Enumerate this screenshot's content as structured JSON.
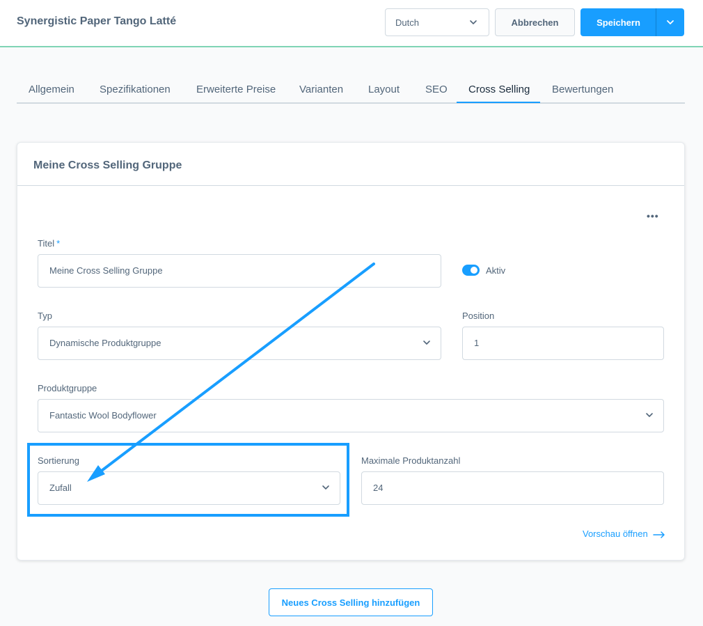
{
  "header": {
    "title": "Synergistic Paper Tango Latté",
    "language": "Dutch",
    "cancel_label": "Abbrechen",
    "save_label": "Speichern"
  },
  "tabs": [
    {
      "label": "Allgemein"
    },
    {
      "label": "Spezifikationen"
    },
    {
      "label": "Erweiterte Preise"
    },
    {
      "label": "Varianten"
    },
    {
      "label": "Layout"
    },
    {
      "label": "SEO"
    },
    {
      "label": "Cross Selling",
      "active": true
    },
    {
      "label": "Bewertungen"
    }
  ],
  "card": {
    "title": "Meine Cross Selling Gruppe",
    "more": "•••",
    "title_field": {
      "label": "Titel",
      "required_mark": "*",
      "value": "Meine Cross Selling Gruppe"
    },
    "active_toggle": {
      "label": "Aktiv",
      "on": true
    },
    "type_field": {
      "label": "Typ",
      "value": "Dynamische Produktgruppe"
    },
    "position_field": {
      "label": "Position",
      "value": "1"
    },
    "product_group_field": {
      "label": "Produktgruppe",
      "value": "Fantastic Wool Bodyflower"
    },
    "sorting_field": {
      "label": "Sortierung",
      "value": "Zufall"
    },
    "max_products_field": {
      "label": "Maximale Produktanzahl",
      "value": "24"
    },
    "preview_link": "Vorschau öffnen"
  },
  "add_button_label": "Neues Cross Selling hinzufügen",
  "colors": {
    "accent": "#189eff",
    "header_border": "#7fd4b5",
    "annotation": "#189eff"
  }
}
